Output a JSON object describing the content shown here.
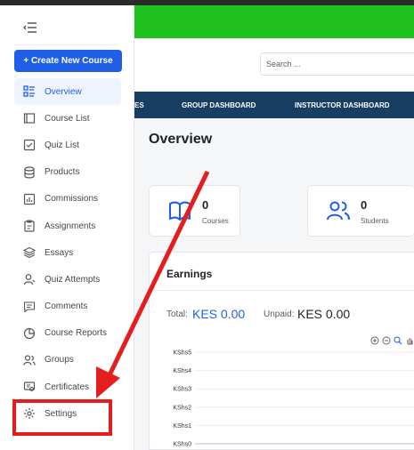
{
  "sidebar": {
    "create_button": "+ Create New Course",
    "items": [
      {
        "label": "Overview",
        "icon": "grid-list-icon"
      },
      {
        "label": "Course List",
        "icon": "book-icon"
      },
      {
        "label": "Quiz List",
        "icon": "checklist-icon"
      },
      {
        "label": "Products",
        "icon": "database-icon"
      },
      {
        "label": "Commissions",
        "icon": "chart-box-icon"
      },
      {
        "label": "Assignments",
        "icon": "assignment-icon"
      },
      {
        "label": "Essays",
        "icon": "layers-icon"
      },
      {
        "label": "Quiz Attempts",
        "icon": "user-attempt-icon"
      },
      {
        "label": "Comments",
        "icon": "comment-icon"
      },
      {
        "label": "Course Reports",
        "icon": "pie-chart-icon"
      },
      {
        "label": "Groups",
        "icon": "users-icon"
      },
      {
        "label": "Certificates",
        "icon": "certificate-icon"
      },
      {
        "label": "Settings",
        "icon": "gear-icon"
      }
    ]
  },
  "header": {
    "search_placeholder": "Search ..."
  },
  "navbar": {
    "items": [
      "ES",
      "GROUP DASHBOARD",
      "INSTRUCTOR DASHBOARD"
    ]
  },
  "main": {
    "title": "Overview",
    "stats": [
      {
        "value": "0",
        "label": "Courses",
        "icon": "open-book-icon"
      },
      {
        "value": "0",
        "label": "Students",
        "icon": "users-icon"
      }
    ],
    "earnings": {
      "title": "Earnings",
      "total_label": "Total:",
      "total_value": "KES 0.00",
      "unpaid_label": "Unpaid:",
      "unpaid_value": "KES 0.00"
    }
  },
  "chart_data": {
    "type": "line",
    "title": "",
    "xlabel": "",
    "ylabel": "",
    "yticks": [
      "KShs5",
      "KShs4",
      "KShs3",
      "KShs2",
      "KShs1",
      "KShs0"
    ],
    "ylim": [
      0,
      5
    ],
    "series": []
  },
  "colors": {
    "accent": "#1f5fe8",
    "topbar_green": "#1fc11f",
    "navbar": "#183e63",
    "annotation_red": "#e41e1e"
  }
}
